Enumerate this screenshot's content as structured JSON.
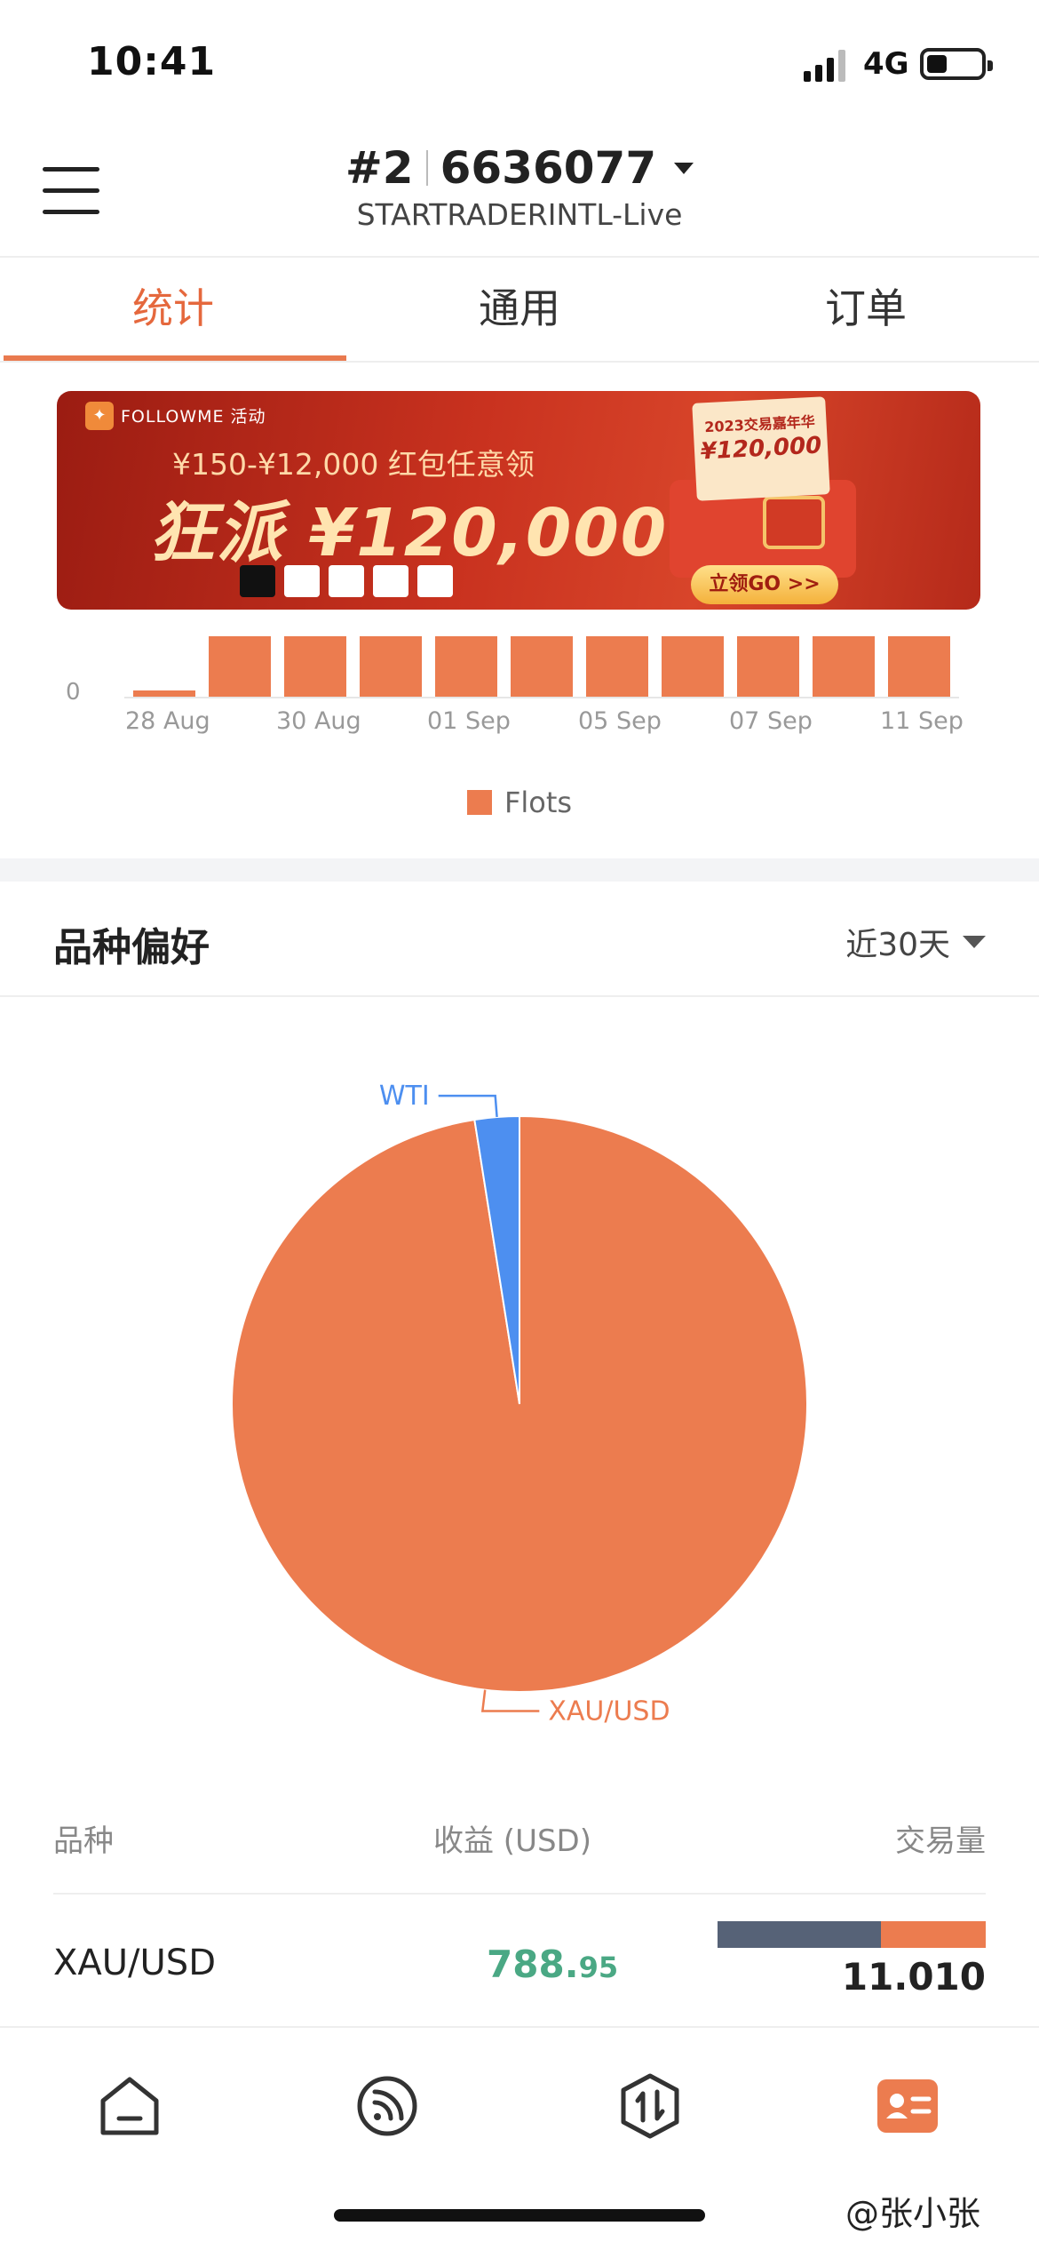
{
  "status_bar": {
    "time": "10:41",
    "network": "4G"
  },
  "header": {
    "account_index": "#2",
    "account_number": "6636077",
    "server": "STARTRADERINTL-Live"
  },
  "tabs": [
    {
      "label": "统计",
      "active": true
    },
    {
      "label": "通用",
      "active": false
    },
    {
      "label": "订单",
      "active": false
    }
  ],
  "banner": {
    "brand": "FOLLOWME 活动",
    "line1": "¥150-¥12,000 红包任意领",
    "line2": "狂派 ¥120,000",
    "card_title": "2023交易嘉年华",
    "card_value": "¥120,000",
    "cta": "立领GO >>"
  },
  "chart_data": [
    {
      "type": "bar",
      "categories": [
        "28 Aug",
        "29 Aug",
        "30 Aug",
        "31 Aug",
        "01 Sep",
        "04 Sep",
        "05 Sep",
        "06 Sep",
        "07 Sep",
        "08 Sep",
        "11 Sep"
      ],
      "x_tick_labels": [
        "28 Aug",
        "30 Aug",
        "01 Sep",
        "05 Sep",
        "07 Sep",
        "11 Sep"
      ],
      "series": [
        {
          "name": "Flots",
          "values": [
            0.5,
            5,
            5,
            5,
            5,
            5,
            5,
            5,
            5,
            5,
            5
          ]
        }
      ],
      "y_tick_labels": [
        "0"
      ],
      "color": "#ec7c4f",
      "legend": "bottom"
    },
    {
      "type": "pie",
      "labels": [
        "XAU/USD",
        "WTI"
      ],
      "values": [
        97.5,
        2.5
      ],
      "colors": [
        "#ec7c4f",
        "#4d8ff0"
      ]
    }
  ],
  "preference": {
    "title": "品种偏好",
    "period": "近30天"
  },
  "table": {
    "headers": [
      "品种",
      "收益 (USD)",
      "交易量"
    ],
    "rows": [
      {
        "symbol": "XAU/USD",
        "profit_int": "788.",
        "profit_dec": "95",
        "volume": "11.010",
        "volume_split": [
          0.61,
          0.39
        ]
      }
    ]
  },
  "bottom_nav": [
    {
      "icon": "home-icon"
    },
    {
      "icon": "feed-icon"
    },
    {
      "icon": "trade-icon"
    },
    {
      "icon": "profile-card-icon",
      "active": true
    }
  ],
  "watermark": "@张小张"
}
